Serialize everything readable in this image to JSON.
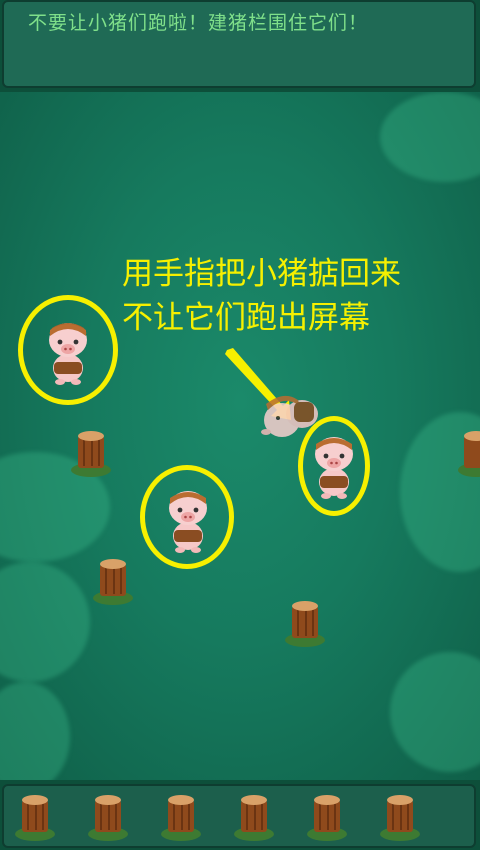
{
  "hint": "不要让小猪们跑啦！建猪栏围住它们！",
  "callout": {
    "line1": "用手指把小猪掂回来",
    "line2": "不让它们跑出屏幕"
  },
  "colors": {
    "hint": "#7fe08a",
    "callout": "#f6f000",
    "ring": "#f7f000"
  },
  "bottom_tray": {
    "slot_count": 6
  }
}
